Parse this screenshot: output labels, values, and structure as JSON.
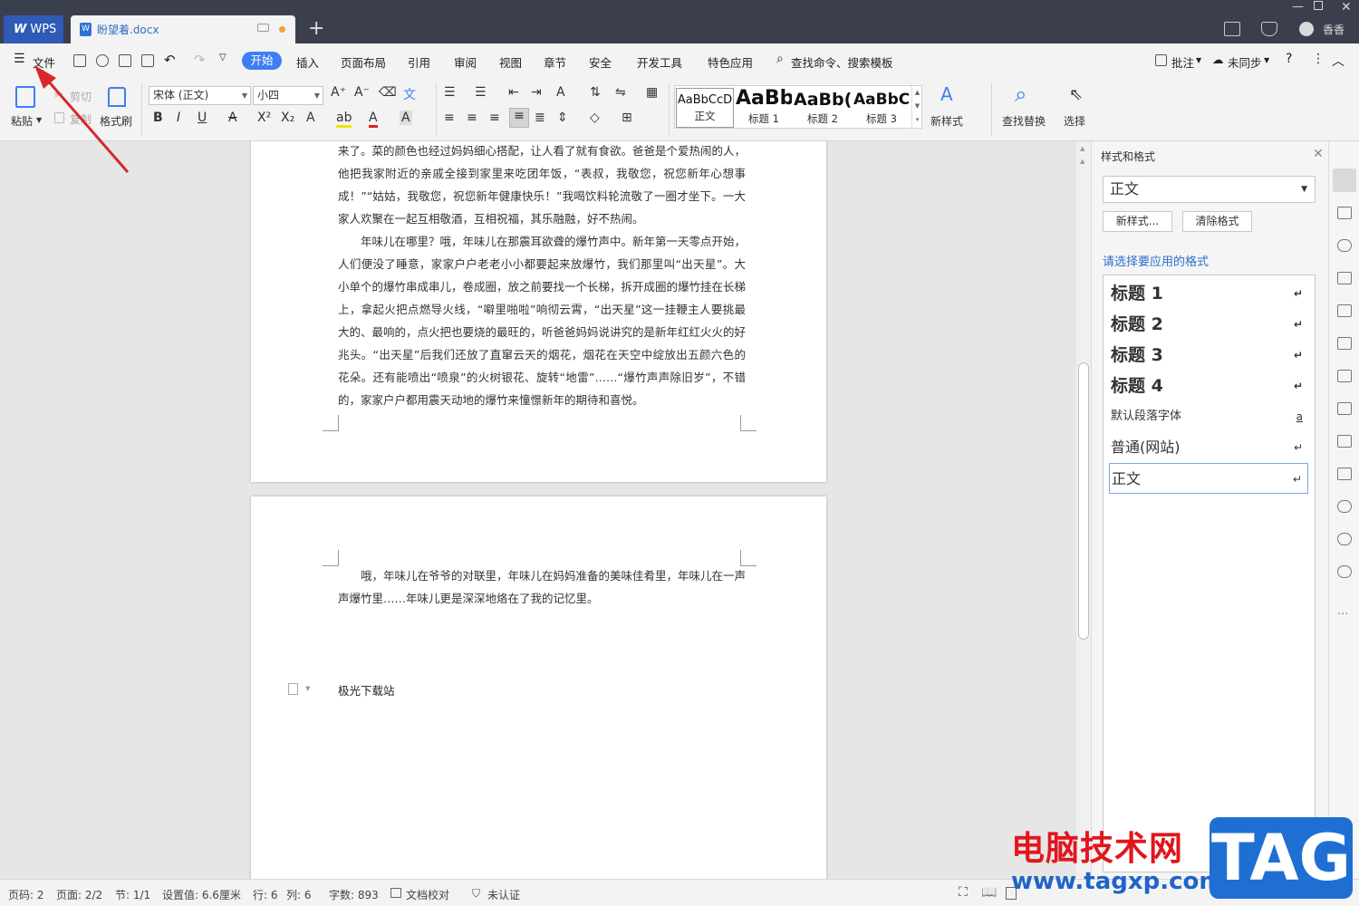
{
  "titlebar": {
    "app_tab": "WPS",
    "doc_tab": "盼望着.docx",
    "user_name": "香香"
  },
  "menubar": {
    "file": "文件",
    "tabs": [
      "开始",
      "插入",
      "页面布局",
      "引用",
      "审阅",
      "视图",
      "章节",
      "安全",
      "开发工具",
      "特色应用"
    ],
    "search": "查找命令、搜索模板",
    "comment": "批注",
    "sync": "未同步"
  },
  "ribbon": {
    "paste": "粘贴",
    "cut": "剪切",
    "copy": "复制",
    "format_painter": "格式刷",
    "font_name": "宋体 (正文)",
    "font_size": "小四",
    "styles": [
      {
        "preview": "AaBbCcD",
        "label": "正文"
      },
      {
        "preview": "AaBb",
        "label": "标题 1"
      },
      {
        "preview": "AaBb(",
        "label": "标题 2"
      },
      {
        "preview": "AaBbC(",
        "label": "标题 3"
      }
    ],
    "new_style": "新样式",
    "find_replace": "查找替换",
    "select": "选择"
  },
  "document": {
    "page1_text": "来了。菜的颜色也经过妈妈细心搭配，让人看了就有食欲。爸爸是个爱热闹的人，他把我家附近的亲戚全接到家里来吃团年饭，“表叔，我敬您，祝您新年心想事成！”“姑姑，我敬您，祝您新年健康快乐！”我喝饮料轮流敬了一圈才坐下。一大家人欢聚在一起互相敬酒，互相祝福，其乐融融，好不热闹。\n　　年味儿在哪里？哦，年味儿在那震耳欲聋的爆竹声中。新年第一天零点开始，人们便没了睡意，家家户户老老小小都要起来放爆竹，我们那里叫“出天星”。大小单个的爆竹串成串儿，卷成圈，放之前要找一个长梯，拆开成圈的爆竹挂在长梯上，拿起火把点燃导火线，“噼里啪啦”响彻云霄，“出天星”这一挂鞭主人要挑最大的、最响的，点火把也要烧的最旺的，听爸爸妈妈说讲究的是新年红红火火的好兆头。“出天星”后我们还放了直窜云天的烟花，烟花在天空中绽放出五颜六色的花朵。还有能喷出“喷泉”的火树银花、旋转“地雷”……“爆竹声声除旧岁”，不错的，家家户户都用震天动地的爆竹来憧憬新年的期待和喜悦。",
    "page2_text": "　　哦，年味儿在爷爷的对联里，年味儿在妈妈准备的美味佳肴里，年味儿在一声声爆竹里……年味儿更是深深地烙在了我的记忆里。",
    "footer_text": "极光下载站"
  },
  "styles_panel": {
    "title": "样式和格式",
    "current_style": "正文",
    "new_style_btn": "新样式...",
    "clear_format_btn": "清除格式",
    "hint": "请选择要应用的格式",
    "items": [
      {
        "label": "标题  1",
        "mark": "↵"
      },
      {
        "label": "标题  2",
        "mark": "↵"
      },
      {
        "label": "标题  3",
        "mark": "↵"
      },
      {
        "label": "标题  4",
        "mark": "↵"
      },
      {
        "label": "默认段落字体",
        "mark": "a"
      },
      {
        "label": "普通(网站)",
        "mark": "↵"
      },
      {
        "label": "正文",
        "mark": "↵"
      }
    ]
  },
  "statusbar": {
    "page_no": "页码: 2",
    "pages": "页面: 2/2",
    "section": "节: 1/1",
    "setting": "设置值: 6.6厘米",
    "row": "行: 6",
    "col": "列: 6",
    "words": "字数: 893",
    "proof": "文档校对",
    "cert": "未认证"
  },
  "watermark": {
    "site_name": "电脑技术网",
    "url": "www.tagxp.com",
    "badge": "TAG"
  },
  "colors": {
    "accent": "#3f7ef2",
    "titlebar": "#3b3f4d",
    "annotation_arrow": "#d9262c"
  }
}
